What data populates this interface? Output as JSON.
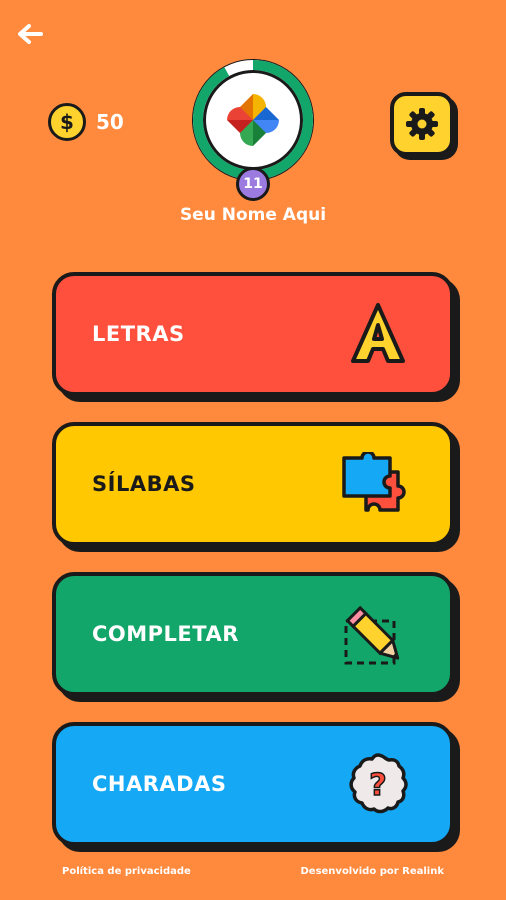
{
  "coins": {
    "count": "50",
    "symbol": "$"
  },
  "player": {
    "name": "Seu Nome Aqui",
    "level": "11",
    "level_progress": 0.92
  },
  "menu": [
    {
      "label": "LETRAS",
      "color": "#FF4F3D",
      "text_color": "#FFFFFF",
      "icon": "letter-a-icon"
    },
    {
      "label": "SÍLABAS",
      "color": "#FFC800",
      "text_color": "#1A1A1A",
      "icon": "puzzle-icon"
    },
    {
      "label": "COMPLETAR",
      "color": "#12A66A",
      "text_color": "#FFFFFF",
      "icon": "pencil-icon"
    },
    {
      "label": "CHARADAS",
      "color": "#14A8F5",
      "text_color": "#FFFFFF",
      "icon": "question-icon"
    }
  ],
  "footer": {
    "privacy": "Política de privacidade",
    "credit": "Desenvolvido por Realink"
  },
  "colors": {
    "background": "#FF8A3D",
    "accent_yellow": "#FFD22E",
    "ring_green": "#12A66A",
    "level_purple": "#9C7BE0"
  }
}
